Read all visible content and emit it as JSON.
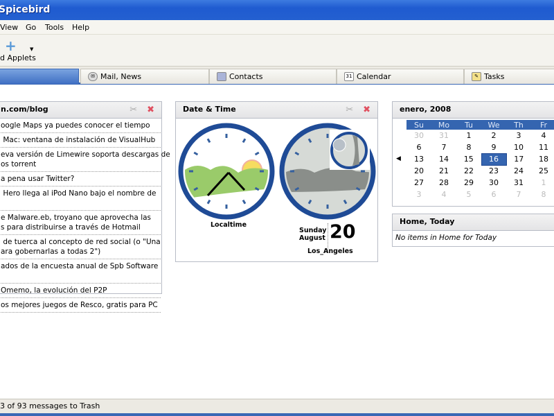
{
  "window": {
    "title": "Spicebird"
  },
  "menu": [
    "View",
    "Go",
    "Tools",
    "Help"
  ],
  "toolbar": {
    "add_applets": "d Applets"
  },
  "tabs": [
    {
      "label": ""
    },
    {
      "label": "Mail, News"
    },
    {
      "label": "Contacts"
    },
    {
      "label": "Calendar"
    },
    {
      "label": "Tasks"
    }
  ],
  "blog": {
    "title": "n.com/blog",
    "items": [
      "oogle Maps ya puedes conocer el tiempo",
      " Mac: ventana de instalación de VisualHub",
      "eva versión de Limewire soporta descargas de\nos torrent",
      "a pena usar Twitter?",
      " Hero llega al iPod Nano bajo el nombre de\n ",
      "e Malware.eb, troyano que aprovecha las\ns para distribuirse a través de Hotmail",
      " de tuerca al concepto de red social (o \"Una\nara gobernarlas a todas 2\")",
      "ados de la encuesta anual de Spb Software\n ",
      "Omemo, la evolución del P2P",
      "os mejores juegos de Resco, gratis para PC"
    ]
  },
  "datetime": {
    "title": "Date & Time",
    "local_label": "Localtime",
    "weekday": "Sunday",
    "month": "August",
    "day": "20",
    "city": "Los_Angeles"
  },
  "calendar": {
    "title": "enero, 2008",
    "weekdays": [
      "Su",
      "Mo",
      "Tu",
      "We",
      "Th",
      "Fr"
    ],
    "weeks": [
      [
        "30",
        "31",
        "1",
        "2",
        "3",
        "4"
      ],
      [
        "6",
        "7",
        "8",
        "9",
        "10",
        "11"
      ],
      [
        "13",
        "14",
        "15",
        "16",
        "17",
        "18"
      ],
      [
        "20",
        "21",
        "22",
        "23",
        "24",
        "25"
      ],
      [
        "27",
        "28",
        "29",
        "30",
        "31",
        "1"
      ],
      [
        "3",
        "4",
        "5",
        "6",
        "7",
        "8"
      ]
    ],
    "selected": "16",
    "accent": "#3565b0"
  },
  "home_today": {
    "title": "Home, Today",
    "empty": "No items in Home for Today"
  },
  "status": {
    "text": "3 of 93 messages to Trash"
  }
}
